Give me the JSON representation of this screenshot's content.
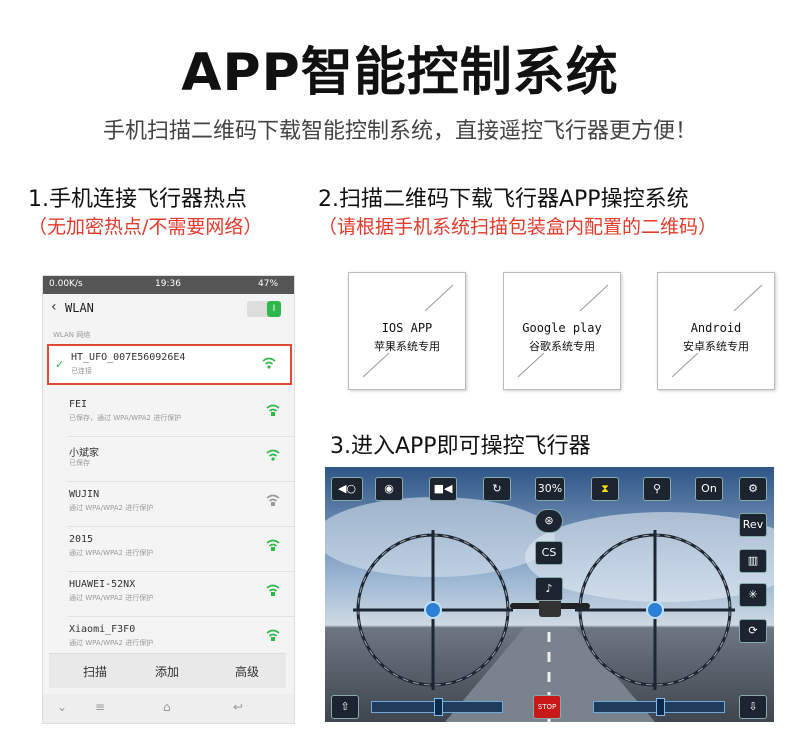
{
  "header": {
    "title": "APP智能控制系统",
    "subtitle": "手机扫描二维码下载智能控制系统，直接遥控飞行器更方便！"
  },
  "steps": {
    "step1": {
      "title": "1.手机连接飞行器热点",
      "note": "（无加密热点/不需要网络）"
    },
    "step2": {
      "title": "2.扫描二维码下载飞行器APP操控系统",
      "note": "（请根据手机系统扫描包装盒内配置的二维码）"
    },
    "step3": {
      "title": "3.进入APP即可操控飞行器"
    }
  },
  "phone": {
    "status": {
      "left": "0.00K/s",
      "time": "19:36",
      "battery": "47%"
    },
    "nav_title": "WLAN",
    "toggle_label": "I",
    "section_label": "WLAN 网络",
    "networks": [
      {
        "name": "HT_UFO_007E560926E4",
        "status": "已连接"
      },
      {
        "name": "FEI",
        "status": "已保存，通过 WPA/WPA2 进行保护"
      },
      {
        "name": "小斌家",
        "status": "已保存"
      },
      {
        "name": "WUJIN",
        "status": "通过 WPA/WPA2 进行保护"
      },
      {
        "name": "2015",
        "status": "通过 WPA/WPA2 进行保护"
      },
      {
        "name": "HUAWEI-52NX",
        "status": "通过 WPA/WPA2 进行保护"
      },
      {
        "name": "Xiaomi_F3F0",
        "status": "通过 WPA/WPA2 进行保护"
      }
    ],
    "actions": {
      "scan": "扫描",
      "add": "添加",
      "advanced": "高级"
    },
    "check_mark": "✓",
    "nav": {
      "menu": "≡",
      "down": "⌄",
      "home": "⌂",
      "back": "↩"
    }
  },
  "qr_boxes": [
    {
      "line1": "IOS APP",
      "line2": "苹果系统专用"
    },
    {
      "line1": "Google play",
      "line2": "谷歌系统专用"
    },
    {
      "line1": "Android",
      "line2": "安卓系统专用"
    }
  ],
  "game": {
    "speed": "30%",
    "on_label": "On",
    "rev_label": "Rev",
    "stop_label": "STOP",
    "aux_label": "CS",
    "accent": "#ffdd00"
  }
}
